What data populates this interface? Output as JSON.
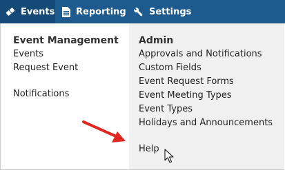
{
  "nav": {
    "events_label": "Events",
    "events_icon": "ticket-icon",
    "reporting_label": "Reporting",
    "reporting_icon": "report-document-icon",
    "settings_label": "Settings",
    "settings_icon": "wrench-icon"
  },
  "menu": {
    "left_heading": "Event Management",
    "left_items": [
      "Events",
      "Request Event",
      "Notifications"
    ],
    "right_heading": "Admin",
    "right_items": [
      "Approvals and Notifications",
      "Custom Fields",
      "Event Request Forms",
      "Event Meeting Types",
      "Event Types",
      "Holidays and Announcements",
      "Help"
    ]
  },
  "annotation": {
    "arrow_color": "#e0261f",
    "arrow_icon": "red-arrow-icon",
    "cursor_icon": "mouse-pointer-icon"
  },
  "colors": {
    "topbar": "#1d5a8e",
    "topbar_active": "#154a78",
    "admin_panel": "#f0f0f0"
  }
}
